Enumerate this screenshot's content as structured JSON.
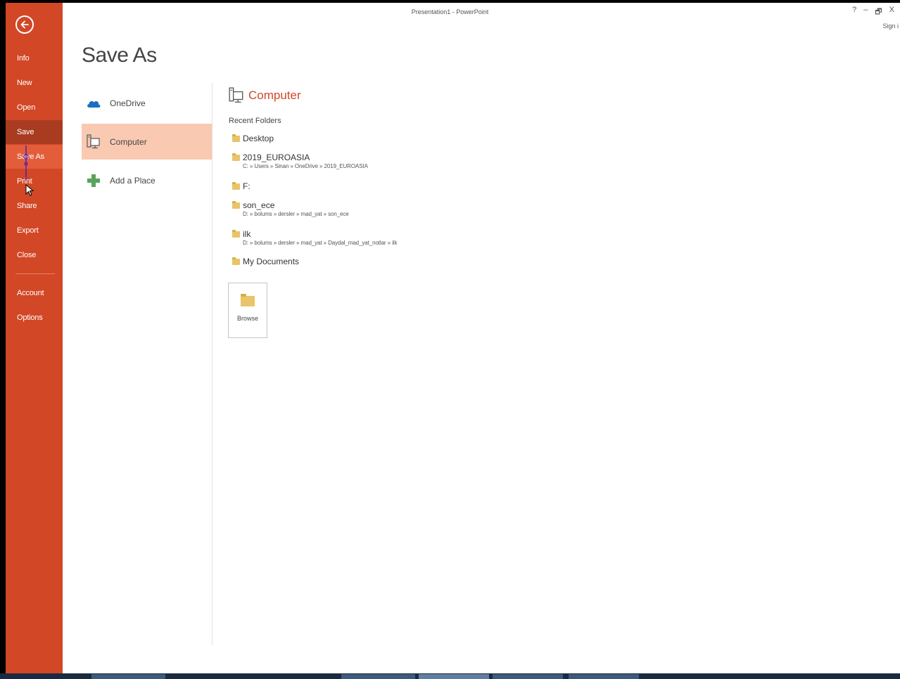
{
  "window": {
    "title": "Presentation1 - PowerPoint",
    "help": "?",
    "minimize": "–",
    "restore": "🗗",
    "close": "X",
    "sign_in": "Sign i"
  },
  "sidebar": {
    "back_icon": "back-arrow-icon",
    "items": [
      {
        "label": "Info"
      },
      {
        "label": "New"
      },
      {
        "label": "Open"
      },
      {
        "label": "Save"
      },
      {
        "label": "Save As"
      },
      {
        "label": "Print"
      },
      {
        "label": "Share"
      },
      {
        "label": "Export"
      },
      {
        "label": "Close"
      },
      {
        "label": "Account"
      },
      {
        "label": "Options"
      }
    ]
  },
  "page": {
    "title": "Save As"
  },
  "places": [
    {
      "label": "OneDrive",
      "icon": "onedrive-cloud-icon"
    },
    {
      "label": "Computer",
      "icon": "computer-icon",
      "selected": true
    },
    {
      "label": "Add a Place",
      "icon": "plus-icon"
    }
  ],
  "panel": {
    "header": "Computer",
    "recent_label": "Recent Folders",
    "folders": [
      {
        "name": "Desktop",
        "path": ""
      },
      {
        "name": "2019_EUROASIA",
        "path": "C: » Users » Sinan » OneDrive » 2019_EUROASIA"
      },
      {
        "name": "F:",
        "path": ""
      },
      {
        "name": "son_ece",
        "path": "D: » bolums » dersler » mad_yat » son_ece"
      },
      {
        "name": "ilk",
        "path": "D: » bolums » dersler » mad_yat » Daydal_mad_yat_notlar » ilk"
      },
      {
        "name": "My Documents",
        "path": ""
      }
    ],
    "browse_label": "Browse"
  },
  "colors": {
    "accent": "#d24726",
    "sidebar_active": "#a93b21",
    "selected_place": "#f9c9b2"
  }
}
